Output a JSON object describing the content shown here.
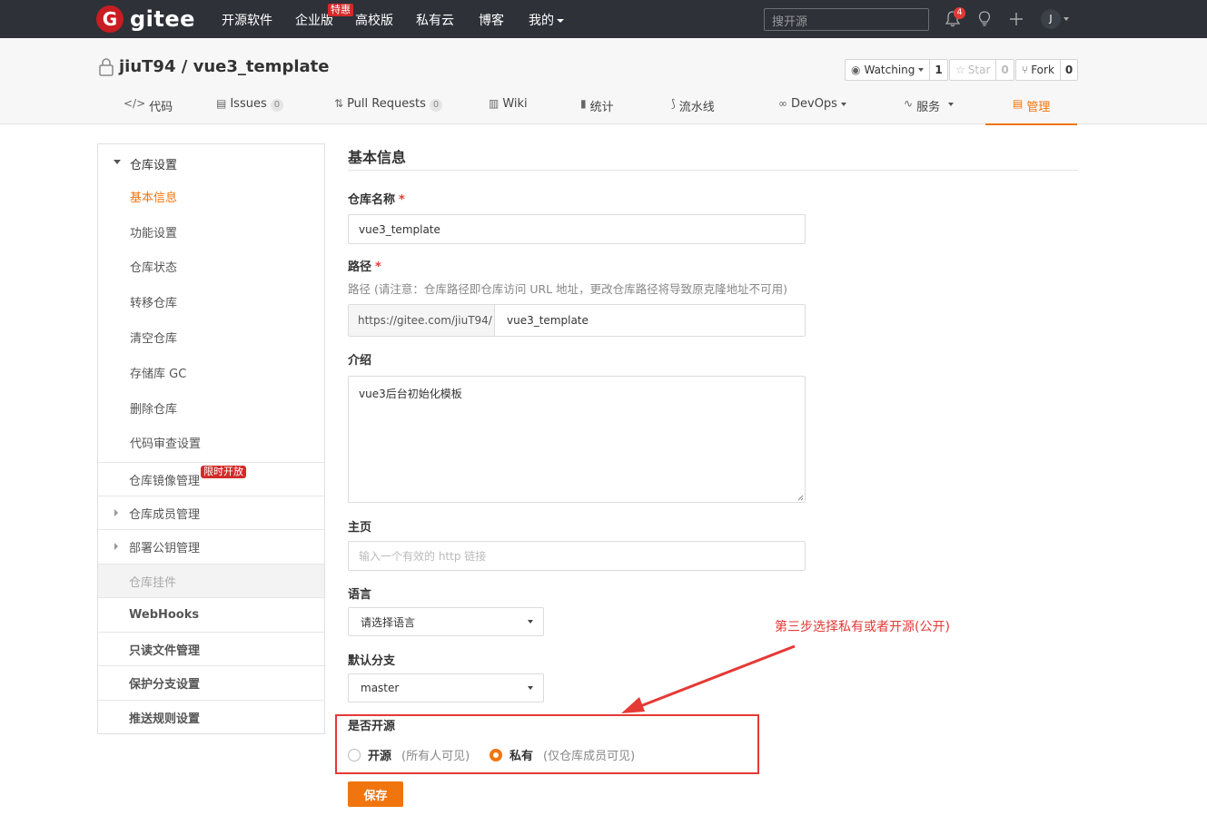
{
  "topnav": {
    "logo_text": "gitee",
    "logo_mark": "G",
    "items": [
      {
        "label": "开源软件"
      },
      {
        "label": "企业版"
      },
      {
        "label": "高校版"
      },
      {
        "label": "私有云"
      },
      {
        "label": "博客"
      },
      {
        "label": "我的"
      }
    ],
    "hot_badge": "特惠",
    "search_placeholder": "搜开源",
    "notification_count": "4",
    "avatar_letter": "J"
  },
  "repo": {
    "title": "jiuT94 / vue3_template",
    "watch": {
      "label": "Watching",
      "count": "1"
    },
    "star": {
      "label": "Star",
      "count": "0"
    },
    "fork": {
      "label": "Fork",
      "count": "0"
    },
    "tabs": [
      {
        "icon": "</>",
        "label": "代码"
      },
      {
        "icon": "▤",
        "label": "Issues",
        "count": "0"
      },
      {
        "icon": "⇅",
        "label": "Pull Requests",
        "count": "0"
      },
      {
        "icon": "▥",
        "label": "Wiki"
      },
      {
        "icon": "▮",
        "label": "统计"
      },
      {
        "icon": "⟆",
        "label": "流水线"
      },
      {
        "icon": "∞",
        "label": "DevOps"
      },
      {
        "icon": "∿",
        "label": "服务"
      },
      {
        "icon": "▤",
        "label": "管理"
      }
    ]
  },
  "sidebar": {
    "group_title": "仓库设置",
    "sub_items": [
      {
        "label": "基本信息"
      },
      {
        "label": "功能设置"
      },
      {
        "label": "仓库状态"
      },
      {
        "label": "转移仓库"
      },
      {
        "label": "清空仓库"
      },
      {
        "label": "存储库 GC"
      },
      {
        "label": "删除仓库"
      },
      {
        "label": "代码审查设置"
      }
    ],
    "mirror": {
      "label": "仓库镜像管理",
      "badge": "限时开放"
    },
    "members": {
      "label": "仓库成员管理"
    },
    "deploy_keys": {
      "label": "部署公钥管理"
    },
    "hooks": {
      "label": "仓库挂件"
    },
    "webhooks": {
      "label": "WebHooks"
    },
    "readonly": {
      "label": "只读文件管理"
    },
    "protect": {
      "label": "保护分支设置"
    },
    "push_rules": {
      "label": "推送规则设置"
    }
  },
  "form": {
    "title": "基本信息",
    "name_label": "仓库名称",
    "name_value": "vue3_template",
    "path_label": "路径",
    "path_hint": "路径 (请注意：仓库路径即仓库访问 URL 地址，更改仓库路径将导致原克隆地址不可用)",
    "path_prefix": "https://gitee.com/jiuT94/",
    "path_value": "vue3_template",
    "desc_label": "介绍",
    "desc_value": "vue3后台初始化模板",
    "homepage_label": "主页",
    "homepage_placeholder": "输入一个有效的 http 链接",
    "language_label": "语言",
    "language_value": "请选择语言",
    "branch_label": "默认分支",
    "branch_value": "master",
    "visibility_label": "是否开源",
    "public_label": "开源",
    "public_note": "(所有人可见)",
    "private_label": "私有",
    "private_note": "(仅仓库成员可见)",
    "selected_visibility": "私有",
    "save_label": "保存"
  },
  "annotation": {
    "text": "第三步选择私有或者开源(公开)",
    "color": "#e53935"
  },
  "colors": {
    "accent": "#f0750f",
    "nav_bg": "#2e3138",
    "brand": "#c71d23"
  }
}
